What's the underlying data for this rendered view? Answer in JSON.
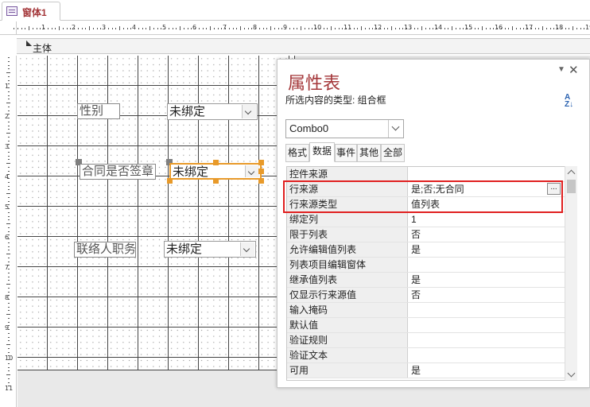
{
  "document_tab": {
    "title": "窗体1"
  },
  "section": {
    "label": "主体"
  },
  "ruler": {
    "h_numbers": [
      "1",
      "2",
      "3",
      "4",
      "5",
      "6",
      "7",
      "8",
      "9",
      "10",
      "11",
      "12",
      "13",
      "14",
      "15",
      "16",
      "17",
      "18",
      "19"
    ],
    "v_numbers": [
      "1",
      "2",
      "3",
      "4",
      "5",
      "6",
      "7",
      "8",
      "9",
      "10",
      "11"
    ]
  },
  "form": {
    "labels": [
      "性别",
      "合同是否签章",
      "联络人职务"
    ],
    "combos": [
      "未绑定",
      "未绑定",
      "未绑定"
    ]
  },
  "property_sheet": {
    "title": "属性表",
    "selection_type": "所选内容的类型: 组合框",
    "object": "Combo0",
    "tabs": [
      "格式",
      "数据",
      "事件",
      "其他",
      "全部"
    ],
    "active_tab": "数据",
    "rows": [
      {
        "name": "控件来源",
        "value": ""
      },
      {
        "name": "行来源",
        "value": "是;否;无合同"
      },
      {
        "name": "行来源类型",
        "value": "值列表"
      },
      {
        "name": "绑定列",
        "value": "1"
      },
      {
        "name": "限于列表",
        "value": "否"
      },
      {
        "name": "允许编辑值列表",
        "value": "是"
      },
      {
        "name": "列表项目编辑窗体",
        "value": ""
      },
      {
        "name": "继承值列表",
        "value": "是"
      },
      {
        "name": "仅显示行来源值",
        "value": "否"
      },
      {
        "name": "输入掩码",
        "value": ""
      },
      {
        "name": "默认值",
        "value": ""
      },
      {
        "name": "验证规则",
        "value": ""
      },
      {
        "name": "验证文本",
        "value": ""
      },
      {
        "name": "可用",
        "value": "是"
      }
    ],
    "builder_button": "...",
    "sort_icon": "A\nZ↓"
  },
  "colors": {
    "accent": "#a4373a",
    "highlight": "#e02020",
    "selection": "#e89a2a"
  }
}
